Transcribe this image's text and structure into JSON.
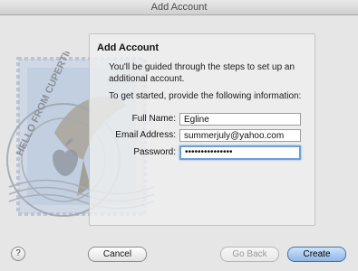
{
  "window": {
    "title": "Add Account"
  },
  "panel": {
    "title": "Add Account",
    "description": "You'll be guided through the steps to set up an additional account.",
    "prompt": "To get started, provide the following information:",
    "fields": {
      "full_name": {
        "label": "Full Name:",
        "value": "Egline"
      },
      "email": {
        "label": "Email Address:",
        "value": "summerjuly@yahoo.com"
      },
      "password": {
        "label": "Password:",
        "value": "•••••••••••••••"
      }
    }
  },
  "buttons": {
    "help": "?",
    "cancel": "Cancel",
    "go_back": "Go Back",
    "create": "Create"
  },
  "stamp": {
    "text": "HELLO FROM CUPERTINO"
  }
}
